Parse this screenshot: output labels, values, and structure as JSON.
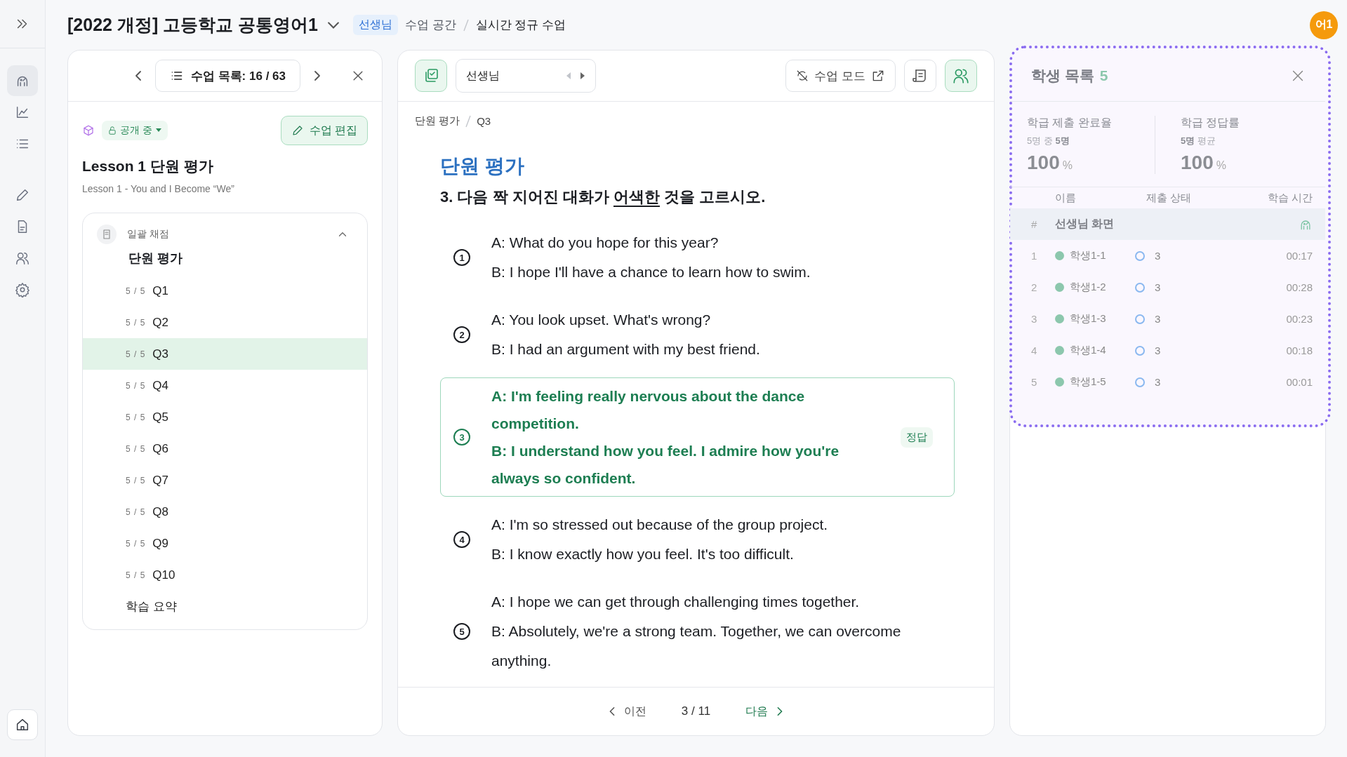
{
  "sidebar": {
    "items": [
      {
        "selected": true
      },
      {
        "selected": false
      },
      {
        "selected": false
      },
      {
        "selected": false
      },
      {
        "selected": false
      },
      {
        "selected": false
      },
      {
        "selected": false
      }
    ]
  },
  "header": {
    "title": "[2022 개정] 고등학교 공통영어1",
    "badge": "선생님",
    "breadcrumb": [
      "수업 공간",
      "실시간 정규 수업"
    ],
    "avatar": "어1"
  },
  "lesson_panel": {
    "nav_label": "수업 목록: 16 / 63",
    "status": "공개 중",
    "edit_button": "수업 편집",
    "title": "Lesson 1 단원 평가",
    "subtitle": "Lesson 1 - You and I Become “We”",
    "group": {
      "label": "일괄 채점",
      "title": "단원 평가",
      "expanded": true,
      "items": [
        {
          "score": "5 / 5",
          "label": "Q1",
          "selected": false
        },
        {
          "score": "5 / 5",
          "label": "Q2",
          "selected": false
        },
        {
          "score": "5 / 5",
          "label": "Q3",
          "selected": true
        },
        {
          "score": "5 / 5",
          "label": "Q4",
          "selected": false
        },
        {
          "score": "5 / 5",
          "label": "Q5",
          "selected": false
        },
        {
          "score": "5 / 5",
          "label": "Q6",
          "selected": false
        },
        {
          "score": "5 / 5",
          "label": "Q7",
          "selected": false
        },
        {
          "score": "5 / 5",
          "label": "Q8",
          "selected": false
        },
        {
          "score": "5 / 5",
          "label": "Q9",
          "selected": false
        },
        {
          "score": "5 / 5",
          "label": "Q10",
          "selected": false
        }
      ],
      "summary": "학습 요약"
    }
  },
  "viewer": {
    "presenter": "선생님",
    "mode_button": "수업 모드",
    "breadcrumb": [
      "단원 평가",
      "Q3"
    ],
    "section_title": "단원 평가",
    "question": {
      "before": "3. 다음 짝 지어진 대화가 ",
      "underlined": "어색한",
      "after": " 것을 고르시오."
    },
    "options": [
      {
        "number": "1",
        "correct": false,
        "lines": [
          "A: What do you hope for this year?",
          "B: I hope I'll have a chance to learn how to swim."
        ]
      },
      {
        "number": "2",
        "correct": false,
        "lines": [
          "A: You look upset. What's wrong?",
          "B: I had an argument with my best friend."
        ]
      },
      {
        "number": "3",
        "correct": true,
        "badge": "정답",
        "lines": [
          "A: I'm feeling really nervous about the dance competition.",
          "B: I understand how you feel. I admire how you're always so confident."
        ]
      },
      {
        "number": "4",
        "correct": false,
        "lines": [
          "A: I'm so stressed out because of the group project.",
          "B: I know exactly how you feel. It's too difficult."
        ]
      },
      {
        "number": "5",
        "correct": false,
        "lines": [
          "A: I hope we can get through challenging times together.",
          "B: Absolutely, we're a strong team. Together, we can overcome anything."
        ]
      }
    ],
    "footer": {
      "prev": "이전",
      "page": "3 / 11",
      "next": "다음"
    }
  },
  "students_panel": {
    "highlighted": true,
    "title": "학생 목록",
    "count": "5",
    "stats": [
      {
        "label": "학급 제출 완료율",
        "sub": "5명 중 **5명**",
        "value": "100",
        "unit": "%"
      },
      {
        "label": "학급 정답률",
        "sub": "**5명** 평균",
        "value": "100",
        "unit": "%"
      }
    ],
    "columns": [
      "이름",
      "제출 상태",
      "학습 시간"
    ],
    "teacher_row": {
      "index": "#",
      "label": "선생님 화면"
    },
    "rows": [
      {
        "index": "1",
        "name": "학생1-1",
        "online": true,
        "submitted": true,
        "score": "3",
        "time": "00:17"
      },
      {
        "index": "2",
        "name": "학생1-2",
        "online": true,
        "submitted": true,
        "score": "3",
        "time": "00:28"
      },
      {
        "index": "3",
        "name": "학생1-3",
        "online": true,
        "submitted": true,
        "score": "3",
        "time": "00:23"
      },
      {
        "index": "4",
        "name": "학생1-4",
        "online": true,
        "submitted": true,
        "score": "3",
        "time": "00:18"
      },
      {
        "index": "5",
        "name": "학생1-5",
        "online": true,
        "submitted": true,
        "score": "3",
        "time": "00:01"
      }
    ]
  }
}
